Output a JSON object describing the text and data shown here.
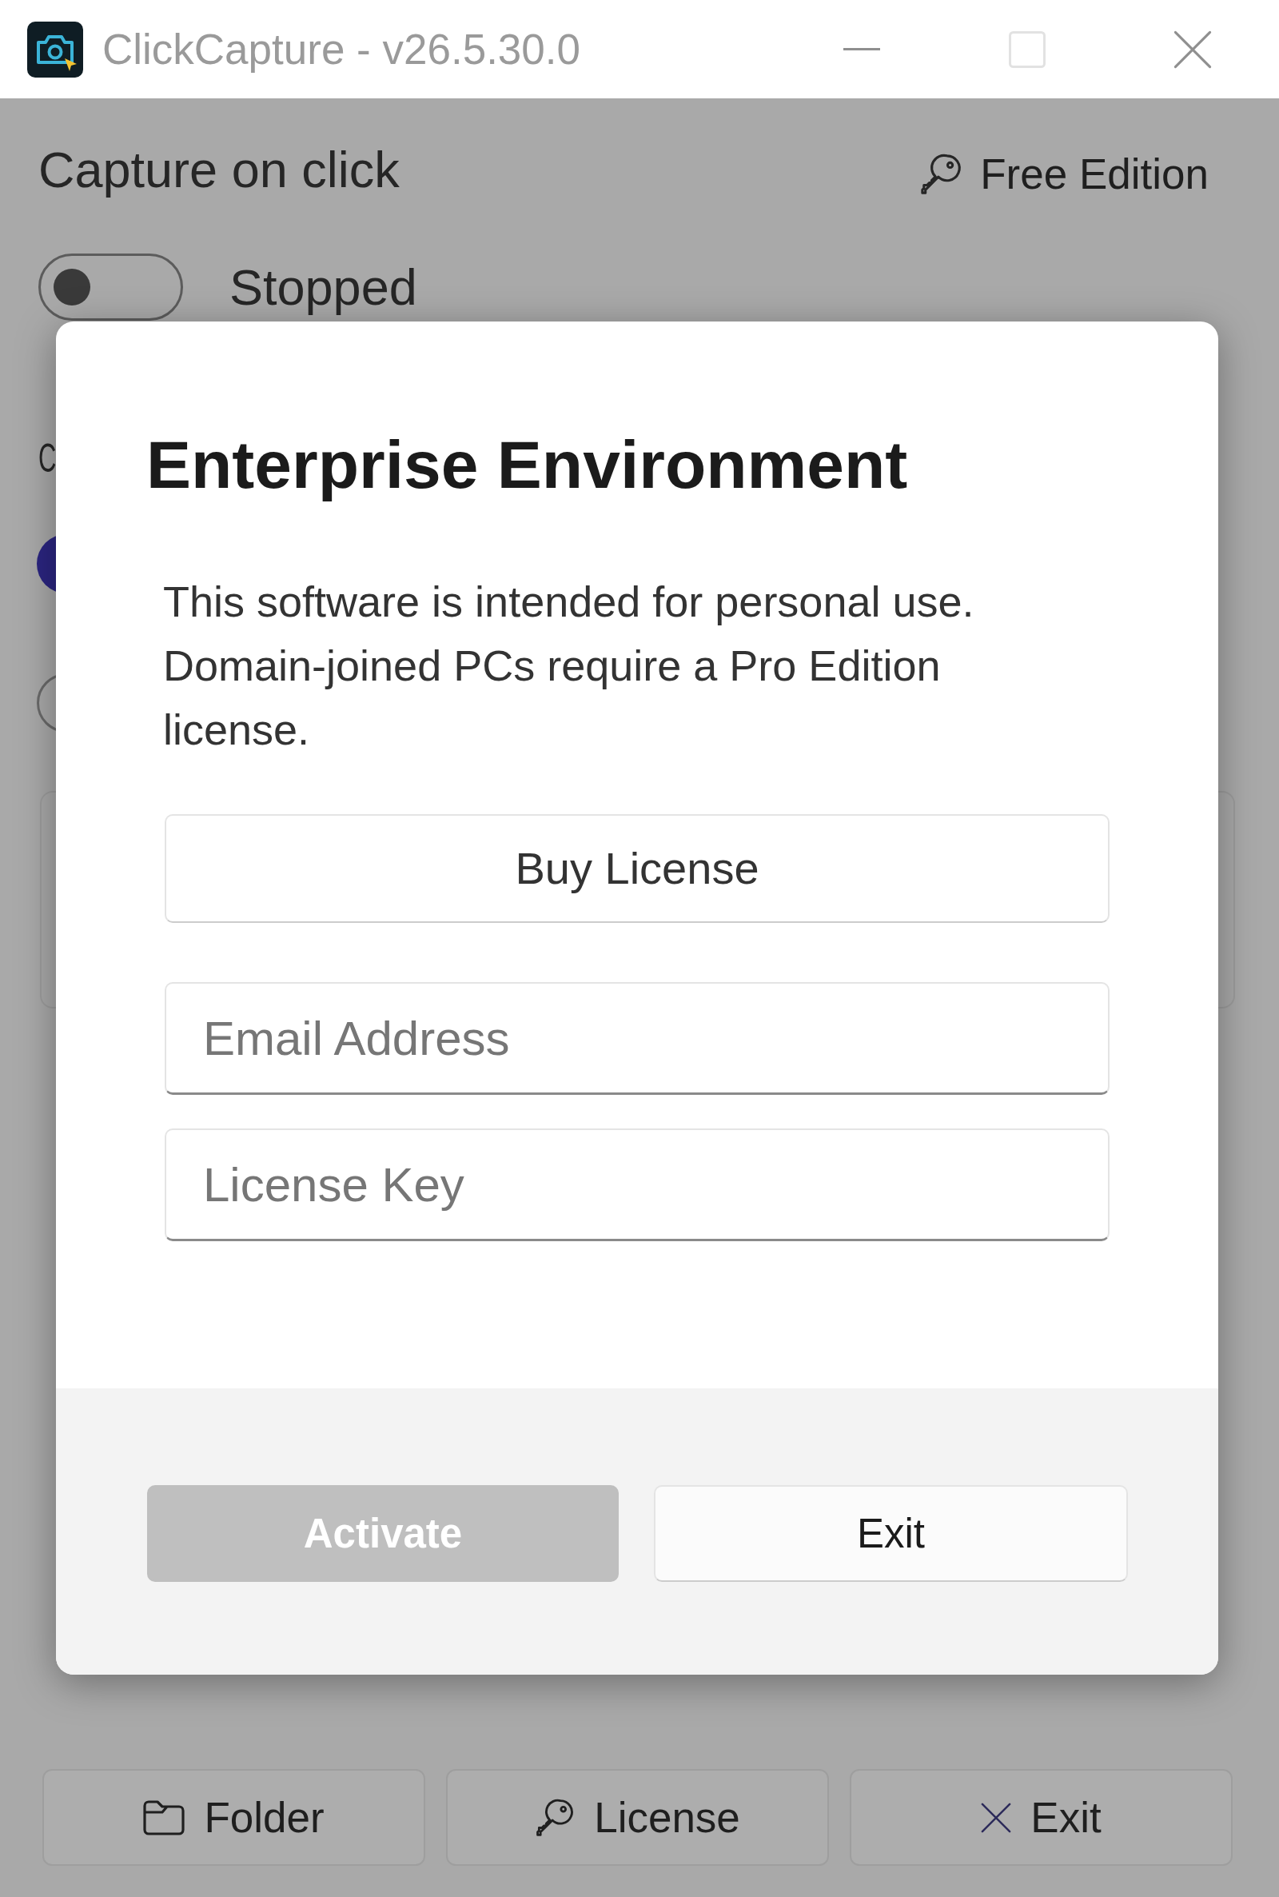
{
  "window": {
    "title": "ClickCapture - v26.5.30.0",
    "controls": [
      {
        "kind": "minimize",
        "disabled": false
      },
      {
        "kind": "maximize",
        "disabled": true
      },
      {
        "kind": "close",
        "disabled": false
      }
    ]
  },
  "header": {
    "title": "Capture on click",
    "edition": "Free Edition"
  },
  "capture_toggle": {
    "on": false,
    "label": "Stopped"
  },
  "section_heading": "C",
  "radio_options": [
    {
      "selected": true
    },
    {
      "selected": false
    }
  ],
  "dialog": {
    "title": "Enterprise Environment",
    "message": "This software is intended for personal use. Domain-joined PCs require a Pro Edition license.",
    "buy_button": "Buy License",
    "fields": [
      {
        "placeholder": "Email Address"
      },
      {
        "placeholder": "License Key"
      }
    ],
    "buttons": [
      {
        "label": "Activate",
        "disabled": true
      },
      {
        "label": "Exit",
        "disabled": false
      }
    ]
  },
  "bottom_buttons": [
    {
      "kind": "folder",
      "label": "Folder"
    },
    {
      "kind": "key",
      "label": "License"
    },
    {
      "kind": "close",
      "label": "Exit"
    }
  ]
}
